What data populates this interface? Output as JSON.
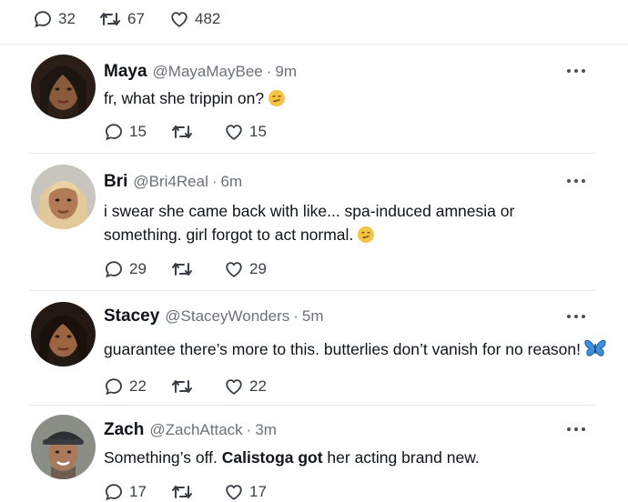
{
  "top_actions": {
    "replies": "32",
    "retweets": "67",
    "likes": "482"
  },
  "tweets": [
    {
      "name": "Maya",
      "handle": "@MayaMayBee",
      "sep": "·",
      "time": "9m",
      "text_a": "fr, what she trippin on?",
      "text_bold": "",
      "text_b": "",
      "emoji": "smirking-face",
      "replies": "15",
      "likes": "15"
    },
    {
      "name": "Bri",
      "handle": "@Bri4Real",
      "sep": "·",
      "time": "6m",
      "text_a": "i swear she came back with like... spa-induced amnesia or something. girl forgot to act normal.",
      "text_bold": "",
      "text_b": "",
      "emoji": "smirking-face",
      "replies": "29",
      "likes": "29"
    },
    {
      "name": "Stacey",
      "handle": "@StaceyWonders",
      "sep": "·",
      "time": "5m",
      "text_a": "guarantee there’s more to this. butterlies don’t vanish for no reason!",
      "text_bold": "",
      "text_b": "",
      "emoji": "butterfly",
      "replies": "22",
      "likes": "22"
    },
    {
      "name": "Zach",
      "handle": "@ZachAttack",
      "sep": "·",
      "time": "3m",
      "text_a": "Something’s off. ",
      "text_bold": "Calistoga got",
      "text_b": " her acting brand new.",
      "emoji": "",
      "replies": "17",
      "likes": "17"
    }
  ],
  "colors": {
    "icon": "#3a3f45",
    "divider": "#e6e9ed",
    "muted": "#6a7178",
    "butterfly": "#3d8fe0"
  }
}
